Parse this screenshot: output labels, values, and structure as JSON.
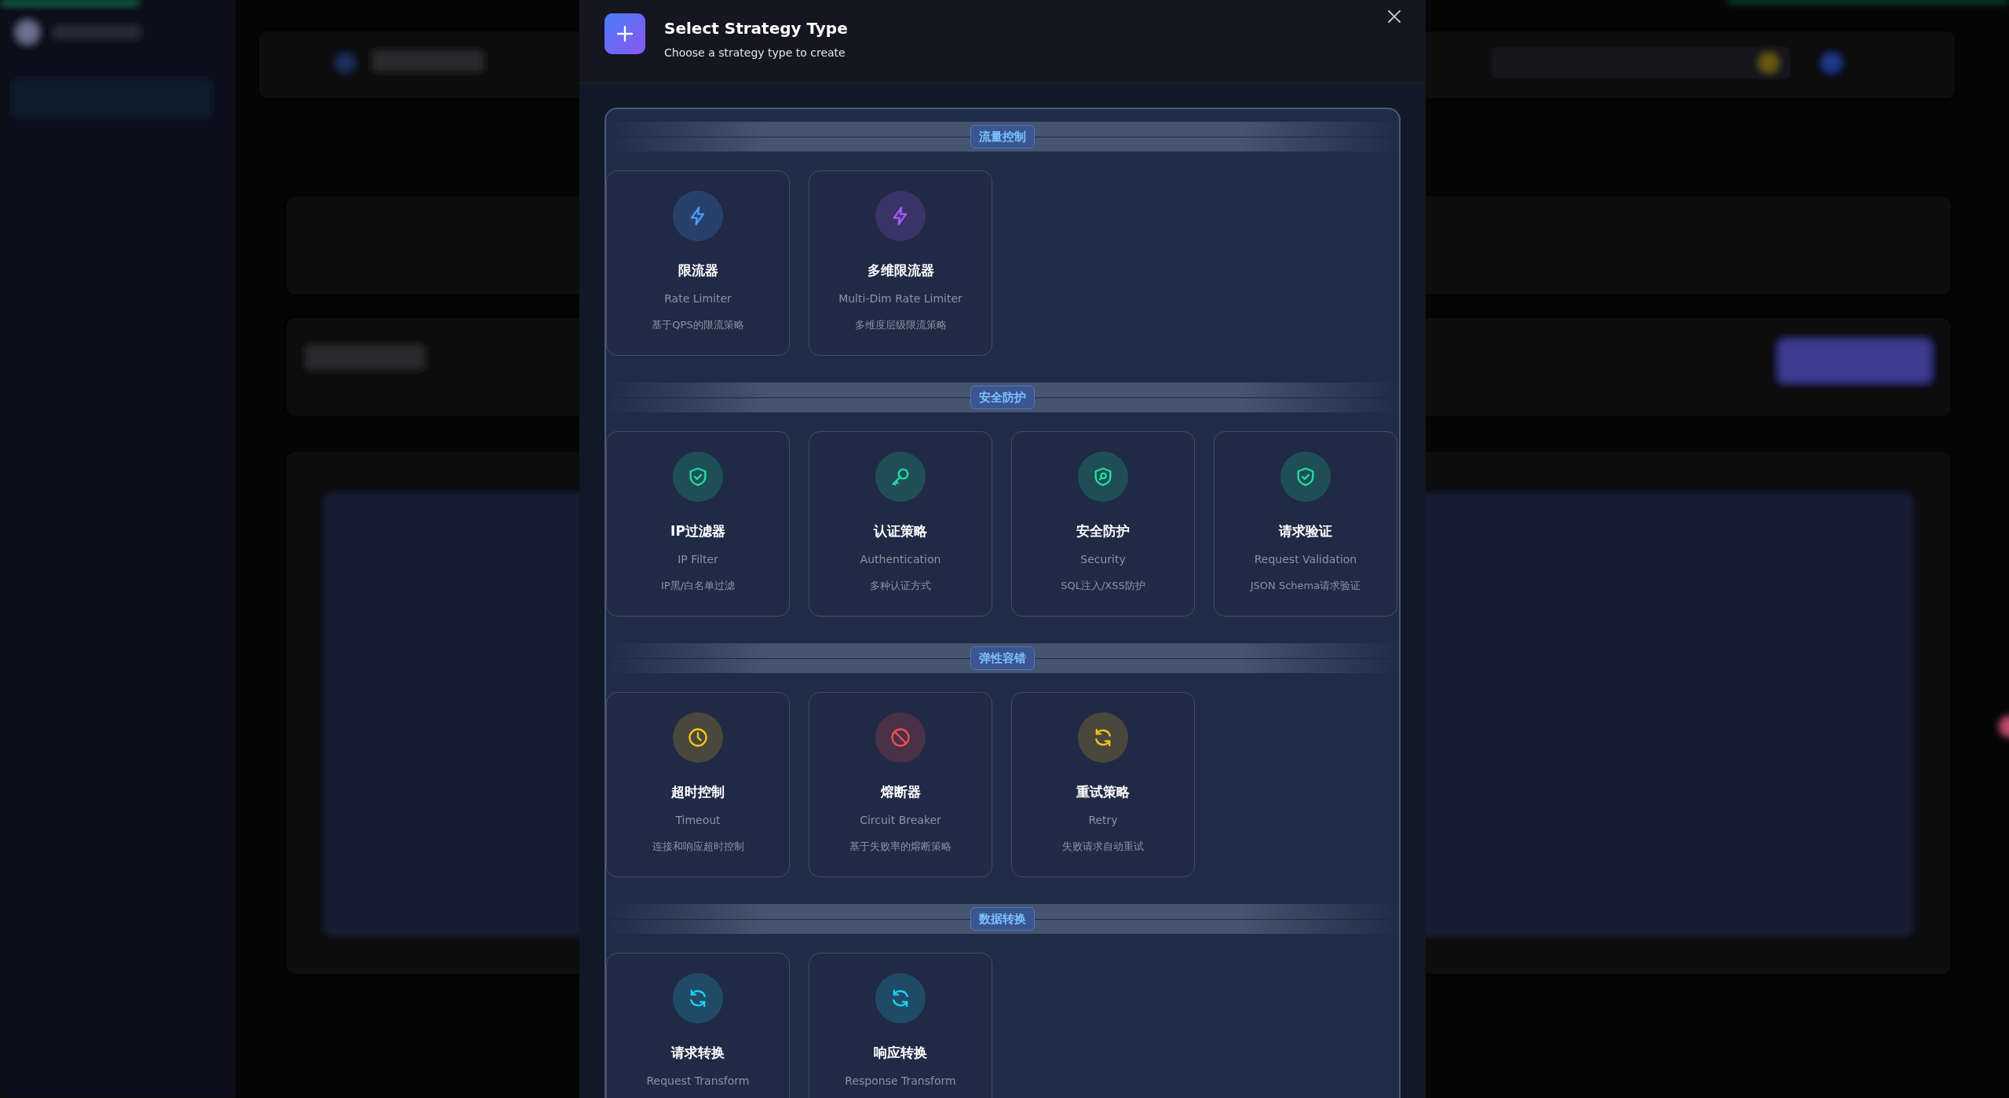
{
  "dialog": {
    "title": "Select Strategy Type",
    "subtitle": "Choose a strategy type to create"
  },
  "sections": [
    {
      "label": "流量控制",
      "items": [
        {
          "name": "限流器",
          "english": "Rate Limiter",
          "description": "基于QPS的限流策略",
          "color": "#4a9eff"
        },
        {
          "name": "多维限流器",
          "english": "Multi-Dim Rate Limiter",
          "description": "多维度层级限流策略",
          "color": "#a35cf5"
        }
      ]
    },
    {
      "label": "安全防护",
      "items": [
        {
          "name": "IP过滤器",
          "english": "IP Filter",
          "description": "IP黑/白名单过滤",
          "color": "#1fe0a0"
        },
        {
          "name": "认证策略",
          "english": "Authentication",
          "description": "多种认证方式",
          "color": "#1fe0a0"
        },
        {
          "name": "安全防护",
          "english": "Security",
          "description": "SQL注入/XSS防护",
          "color": "#1fe0a0"
        },
        {
          "name": "请求验证",
          "english": "Request Validation",
          "description": "JSON Schema请求验证",
          "color": "#1fe0a0"
        }
      ]
    },
    {
      "label": "弹性容错",
      "items": [
        {
          "name": "超时控制",
          "english": "Timeout",
          "description": "连接和响应超时控制",
          "color": "#f5c518"
        },
        {
          "name": "熔断器",
          "english": "Circuit Breaker",
          "description": "基于失败率的熔断策略",
          "color": "#f04e4e"
        },
        {
          "name": "重试策略",
          "english": "Retry",
          "description": "失败请求自动重试",
          "color": "#f5c518"
        }
      ]
    },
    {
      "label": "数据转换",
      "items": [
        {
          "name": "请求转换",
          "english": "Request Transform",
          "color": "#1fd0f0"
        },
        {
          "name": "响应转换",
          "english": "Response Transform",
          "color": "#1fd0f0"
        }
      ]
    }
  ]
}
